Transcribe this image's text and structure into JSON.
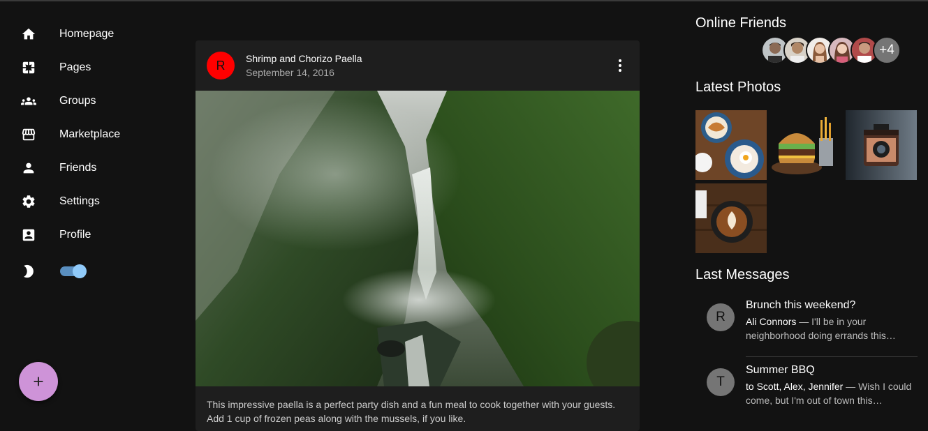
{
  "nav": {
    "items": [
      {
        "label": "Homepage",
        "icon": "home-icon"
      },
      {
        "label": "Pages",
        "icon": "pages-icon"
      },
      {
        "label": "Groups",
        "icon": "groups-icon"
      },
      {
        "label": "Marketplace",
        "icon": "storefront-icon"
      },
      {
        "label": "Friends",
        "icon": "person-icon"
      },
      {
        "label": "Settings",
        "icon": "gear-icon"
      },
      {
        "label": "Profile",
        "icon": "account-box-icon"
      }
    ],
    "dark_mode_on": true
  },
  "fab": {
    "icon": "plus-icon"
  },
  "post": {
    "avatar_letter": "R",
    "title": "Shrimp and Chorizo Paella",
    "date": "September 14, 2016",
    "body": "This impressive paella is a perfect party dish and a fun meal to cook together with your guests. Add 1 cup of frozen peas along with the mussels, if you like."
  },
  "online_friends": {
    "title": "Online Friends",
    "more_count": "+4"
  },
  "latest_photos": {
    "title": "Latest Photos"
  },
  "messages": {
    "title": "Last Messages",
    "items": [
      {
        "avatar": "R",
        "title": "Brunch this weekend?",
        "sender": "Ali Connors",
        "text": " — I'll be in your neighborhood doing errands this…"
      },
      {
        "avatar": "T",
        "title": "Summer BBQ",
        "sender": "to Scott, Alex, Jennifer",
        "text": " — Wish I could come, but I'm out of town this…"
      }
    ]
  },
  "colors": {
    "accent": "#90caf9",
    "fab": "#ce93d8",
    "avatar_red": "#ff0000",
    "background": "#121212",
    "card": "#1e1e1e"
  }
}
